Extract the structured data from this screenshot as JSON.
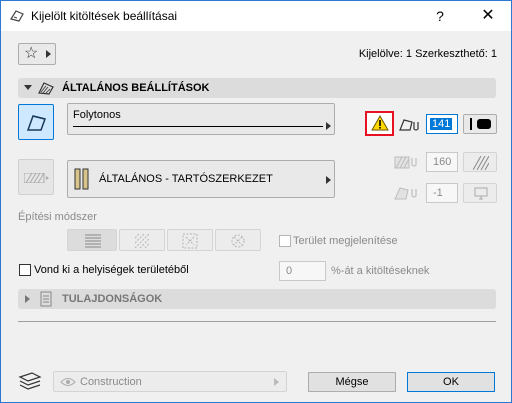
{
  "window": {
    "title": "Kijelölt kitöltések beállításai",
    "help_glyph": "?",
    "close_glyph": "✕"
  },
  "header": {
    "selection_info": "Kijelölve: 1 Szerkeszthető: 1"
  },
  "general_section": {
    "label": "ÁLTALÁNOS BEÁLLÍTÁSOK",
    "line_type": "Folytonos",
    "pen_number": "141",
    "background_pen": "160",
    "transparency_pen": "-1",
    "building_material": "ÁLTALÁNOS - TARTÓSZERKEZET",
    "construction_method_label": "Építési módszer",
    "show_area_label": "Terület megjelenítése",
    "show_area_checked": false,
    "subtract_label": "Vond ki a helyiségek területéből",
    "subtract_checked": false,
    "percent_value": "0",
    "percent_suffix": "%-át a kitöltéseknek"
  },
  "properties_section": {
    "label": "TULAJDONSÁGOK"
  },
  "footer": {
    "layer_name": "Construction",
    "cancel_label": "Mégse",
    "ok_label": "OK"
  },
  "colors": {
    "warning_border": "#e81123",
    "warning_fill": "#ffd800",
    "pen_highlight": "#0078d7",
    "window_border": "#2b79d0"
  }
}
